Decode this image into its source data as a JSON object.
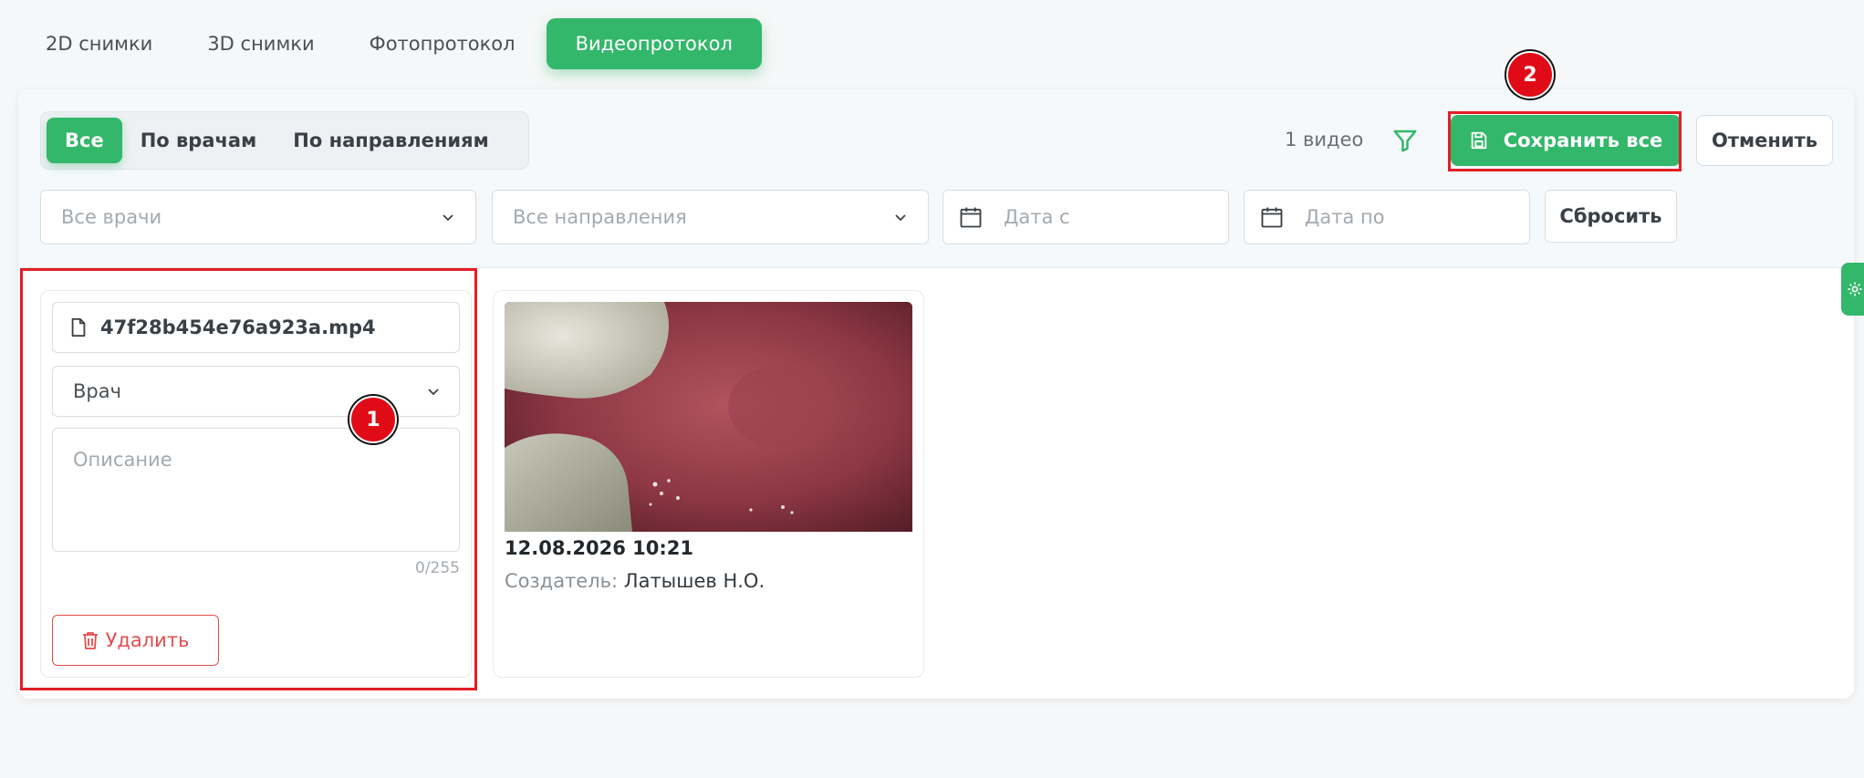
{
  "top_tabs": {
    "items": [
      {
        "label": "2D снимки"
      },
      {
        "label": "3D снимки"
      },
      {
        "label": "Фотопротокол"
      },
      {
        "label": "Видеопротокол"
      }
    ],
    "active": "Видеопротокол"
  },
  "segment": {
    "items": [
      {
        "label": "Все"
      },
      {
        "label": "По врачам"
      },
      {
        "label": "По направлениям"
      }
    ],
    "active": "Все"
  },
  "toolbar": {
    "count_text": "1 видео",
    "filter_icon": "filter-icon",
    "save_label": "Сохранить все",
    "cancel_label": "Отменить"
  },
  "filters": {
    "doctors_placeholder": "Все врачи",
    "directions_placeholder": "Все направления",
    "date_from_placeholder": "Дата с",
    "date_to_placeholder": "Дата по",
    "reset_label": "Сбросить"
  },
  "edit_panel": {
    "filename": "47f28b454e76a923a.mp4",
    "doctor_placeholder": "Врач",
    "description_placeholder": "Описание",
    "counter": "0/255",
    "delete_label": "Удалить"
  },
  "video": {
    "datetime": "12.08.2026 10:21",
    "creator_label": "Создатель:",
    "creator_name": "Латышев Н.О."
  },
  "annotations": {
    "badge_1": "1",
    "badge_2": "2",
    "highlight_color": "#e21e26"
  },
  "colors": {
    "accent": "#33b76a",
    "danger": "#e24d4d"
  }
}
